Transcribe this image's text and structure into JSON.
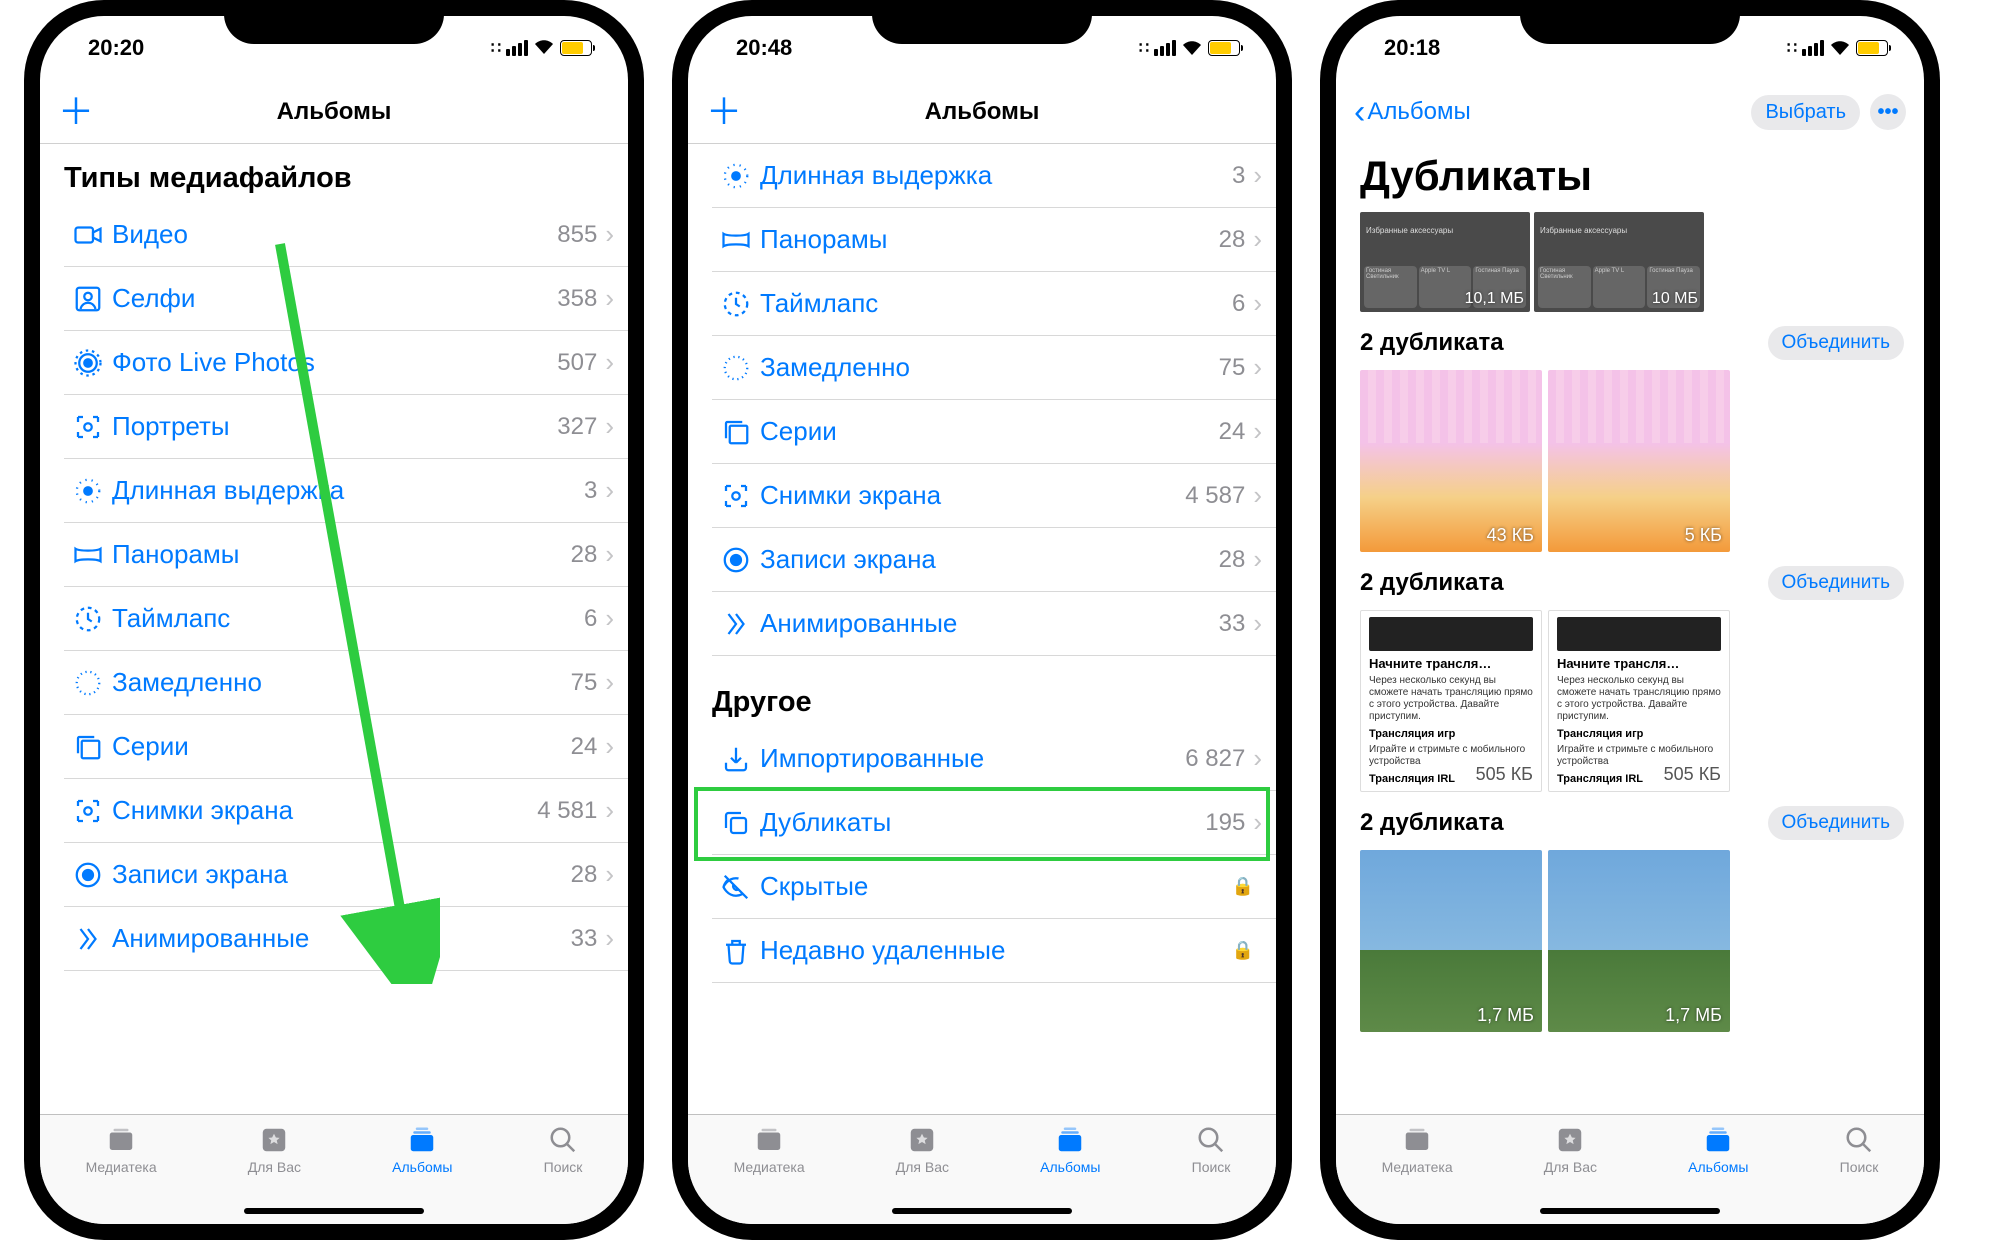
{
  "status": {
    "battery_color": "#ffcc00"
  },
  "phone1": {
    "time": "20:20",
    "nav_title": "Альбомы",
    "section": "Типы медиафайлов",
    "rows": [
      {
        "icon": "video",
        "label": "Видео",
        "count": "855"
      },
      {
        "icon": "selfie",
        "label": "Селфи",
        "count": "358"
      },
      {
        "icon": "live",
        "label": "Фото Live Photos",
        "count": "507"
      },
      {
        "icon": "portrait",
        "label": "Портреты",
        "count": "327"
      },
      {
        "icon": "longexp",
        "label": "Длинная выдержка",
        "count": "3"
      },
      {
        "icon": "pano",
        "label": "Панорамы",
        "count": "28"
      },
      {
        "icon": "timelapse",
        "label": "Таймлапс",
        "count": "6"
      },
      {
        "icon": "slomo",
        "label": "Замедленно",
        "count": "75"
      },
      {
        "icon": "burst",
        "label": "Серии",
        "count": "24"
      },
      {
        "icon": "screenshot",
        "label": "Снимки экрана",
        "count": "4 581"
      },
      {
        "icon": "screenrec",
        "label": "Записи экрана",
        "count": "28"
      },
      {
        "icon": "animated",
        "label": "Анимированные",
        "count": "33"
      }
    ]
  },
  "phone2": {
    "time": "20:48",
    "nav_title": "Альбомы",
    "rows_top": [
      {
        "icon": "longexp",
        "label": "Длинная выдержка",
        "count": "3"
      },
      {
        "icon": "pano",
        "label": "Панорамы",
        "count": "28"
      },
      {
        "icon": "timelapse",
        "label": "Таймлапс",
        "count": "6"
      },
      {
        "icon": "slomo",
        "label": "Замедленно",
        "count": "75"
      },
      {
        "icon": "burst",
        "label": "Серии",
        "count": "24"
      },
      {
        "icon": "screenshot",
        "label": "Снимки экрана",
        "count": "4 587"
      },
      {
        "icon": "screenrec",
        "label": "Записи экрана",
        "count": "28"
      },
      {
        "icon": "animated",
        "label": "Анимированные",
        "count": "33"
      }
    ],
    "section2": "Другое",
    "rows_other": [
      {
        "icon": "import",
        "label": "Импортированные",
        "count": "6 827"
      },
      {
        "icon": "dup",
        "label": "Дубликаты",
        "count": "195"
      },
      {
        "icon": "hidden",
        "label": "Скрытые",
        "lock": true
      },
      {
        "icon": "trash",
        "label": "Недавно удаленные",
        "lock": true
      }
    ]
  },
  "phone3": {
    "time": "20:18",
    "back": "Альбомы",
    "select": "Выбрать",
    "title": "Дубликаты",
    "merge": "Объединить",
    "strip_top": [
      {
        "size": "10,1 МБ"
      },
      {
        "size": "10 МБ"
      }
    ],
    "groups": [
      {
        "title": "2 дубликата",
        "sizes": [
          "43 КБ",
          "5 КБ"
        ],
        "type": "grad"
      },
      {
        "title": "2 дубликата",
        "sizes": [
          "505 КБ",
          "505 КБ"
        ],
        "type": "white",
        "card": {
          "h": "Начните трансля…",
          "l1": "Через несколько секунд вы сможете начать трансляцию прямо с этого устройства. Давайте приступим.",
          "l2": "Трансляция игр",
          "l3": "Играйте и стримьте с мобильного устройства",
          "l4": "Трансляция IRL"
        }
      },
      {
        "title": "2 дубликата",
        "sizes": [
          "1,7 МБ",
          "1,7 МБ"
        ],
        "type": "sky"
      }
    ],
    "home_tile_hdr": "Избранные аксессуары",
    "home_tiles": [
      "Гостиная Светильник",
      "Apple TV L",
      "Гостиная Пауза"
    ]
  },
  "tabs": [
    {
      "label": "Медиатека",
      "icon": "lib"
    },
    {
      "label": "Для Вас",
      "icon": "foryou"
    },
    {
      "label": "Альбомы",
      "icon": "albums",
      "active": true
    },
    {
      "label": "Поиск",
      "icon": "search"
    }
  ]
}
